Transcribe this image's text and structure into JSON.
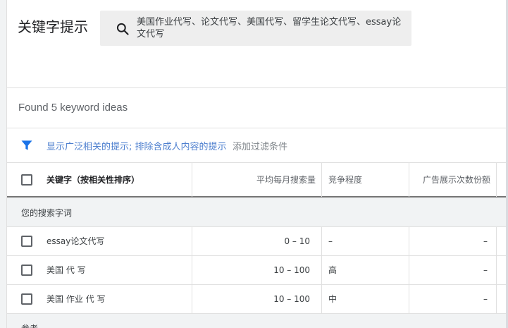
{
  "page": {
    "title": "关键字提示"
  },
  "search": {
    "query": "美国作业代写、论文代写、美国代写、留学生论文代写、essay论文代写"
  },
  "results": {
    "found_text": "Found 5 keyword ideas"
  },
  "filters": {
    "active_filter": "显示广泛相关的提示; 排除含成人内容的提示",
    "add_filter": "添加过滤条件"
  },
  "table": {
    "headers": {
      "keyword": "关键字（按相关性排序）",
      "avg_searches": "平均每月搜索量",
      "competition": "竞争程度",
      "ad_impression_share": "广告展示次数份额"
    },
    "group_label": "您的搜索字词",
    "rows": [
      {
        "keyword": "essay论文代写",
        "avg_searches": "0 – 10",
        "competition": "–",
        "ad_impression_share": "–"
      },
      {
        "keyword": "美国 代 写",
        "avg_searches": "10 – 100",
        "competition": "高",
        "ad_impression_share": "–"
      },
      {
        "keyword": "美国 作业 代 写",
        "avg_searches": "10 – 100",
        "competition": "中",
        "ad_impression_share": "–"
      }
    ],
    "bottom_group_label": "参考"
  },
  "colors": {
    "link": "#4d7fcf",
    "filter_icon": "#1a73e8"
  },
  "icons": {
    "search": "search-icon",
    "filter": "filter-icon"
  }
}
